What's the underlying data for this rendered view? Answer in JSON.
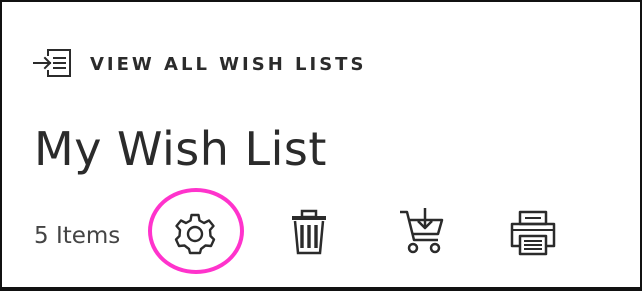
{
  "nav": {
    "back_label": "VIEW ALL WISH LISTS",
    "back_icon": "list-arrow-in-icon"
  },
  "page": {
    "title": "My Wish List",
    "item_count": "5 Items"
  },
  "toolbar": {
    "icons": [
      "gear-icon",
      "trash-icon",
      "add-to-cart-icon",
      "printer-icon"
    ]
  },
  "colors": {
    "text": "#2b2b2b",
    "highlight": "#ff33cc",
    "border": "#111111"
  }
}
